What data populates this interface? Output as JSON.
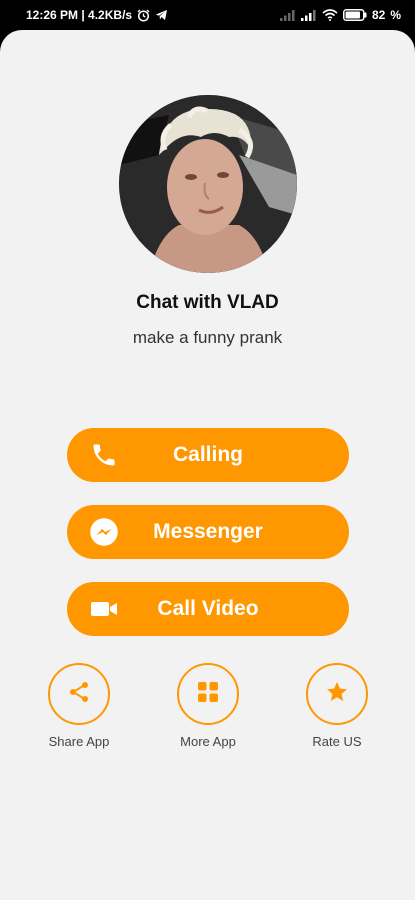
{
  "status_bar": {
    "time_speed": "12:26 PM | 4.2KB/s",
    "battery": "82"
  },
  "profile": {
    "title": "Chat with VLAD",
    "subtitle": "make a funny prank"
  },
  "buttons": {
    "calling": "Calling",
    "messenger": "Messenger",
    "video": "Call Video"
  },
  "actions": {
    "share": "Share App",
    "more": "More App",
    "rate": "Rate US"
  },
  "colors": {
    "accent": "#ff9800",
    "background": "#f2f2f2",
    "status_bar": "#000000"
  },
  "icons": [
    "alarm-icon",
    "telegram-icon",
    "signal-icon",
    "wifi-icon",
    "battery-icon",
    "phone-icon",
    "messenger-icon",
    "video-camera-icon",
    "share-icon",
    "grid-icon",
    "star-icon"
  ]
}
